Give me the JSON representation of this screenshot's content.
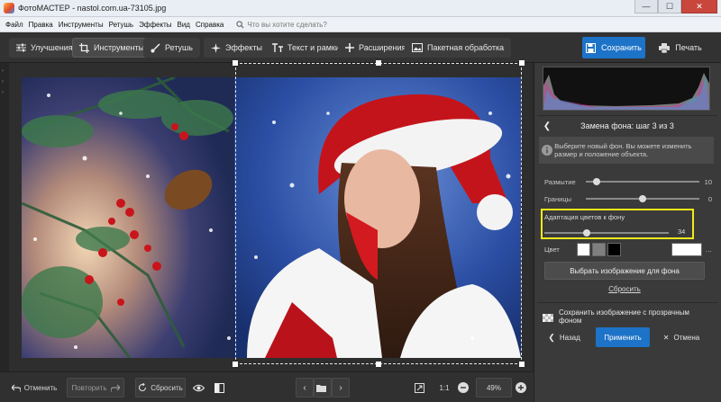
{
  "window": {
    "title": "ФотоМАСТЕР - nastol.com.ua-73105.jpg",
    "minimize": "—",
    "maximize": "☐",
    "close": "✕"
  },
  "menu": {
    "items": [
      "Файл",
      "Правка",
      "Инструменты",
      "Ретушь",
      "Эффекты",
      "Вид",
      "Справка"
    ],
    "search_placeholder": "Что вы хотите сделать?"
  },
  "toolbar": {
    "tabs": [
      {
        "label": "Улучшения",
        "icon": "sliders-icon"
      },
      {
        "label": "Инструменты",
        "icon": "crop-icon"
      },
      {
        "label": "Ретушь",
        "icon": "brush-icon"
      },
      {
        "label": "Эффекты",
        "icon": "sparkle-icon"
      },
      {
        "label": "Текст и рамки",
        "icon": "text-icon"
      },
      {
        "label": "Расширения",
        "icon": "plus-icon"
      },
      {
        "label": "Пакетная обработка",
        "icon": "batch-icon"
      }
    ],
    "active_tab": "Инструменты",
    "save_label": "Сохранить",
    "print_label": "Печать"
  },
  "bottombar": {
    "undo": "Отменить",
    "redo": "Повторить",
    "reset": "Сбросить",
    "ratio": "1:1",
    "zoom": "49%"
  },
  "panel": {
    "title": "Замена фона: шаг 3 из 3",
    "info": "Выберите новый фон. Вы можете изменить размер и положение объекта.",
    "sliders": [
      {
        "label": "Размытие",
        "value": 10
      },
      {
        "label": "Границы",
        "value": 0
      }
    ],
    "adapt": {
      "label": "Адаптация цветов к фону",
      "value": 34
    },
    "color_label": "Цвет",
    "colors": [
      "#ffffff",
      "#7f7f7f",
      "#000000"
    ],
    "choose_bg": "Выбрать изображение для фона",
    "reset": "Сбросить",
    "save_transparent": "Сохранить изображение с прозрачным фоном",
    "back": "Назад",
    "apply": "Применить",
    "cancel": "Отмена"
  }
}
